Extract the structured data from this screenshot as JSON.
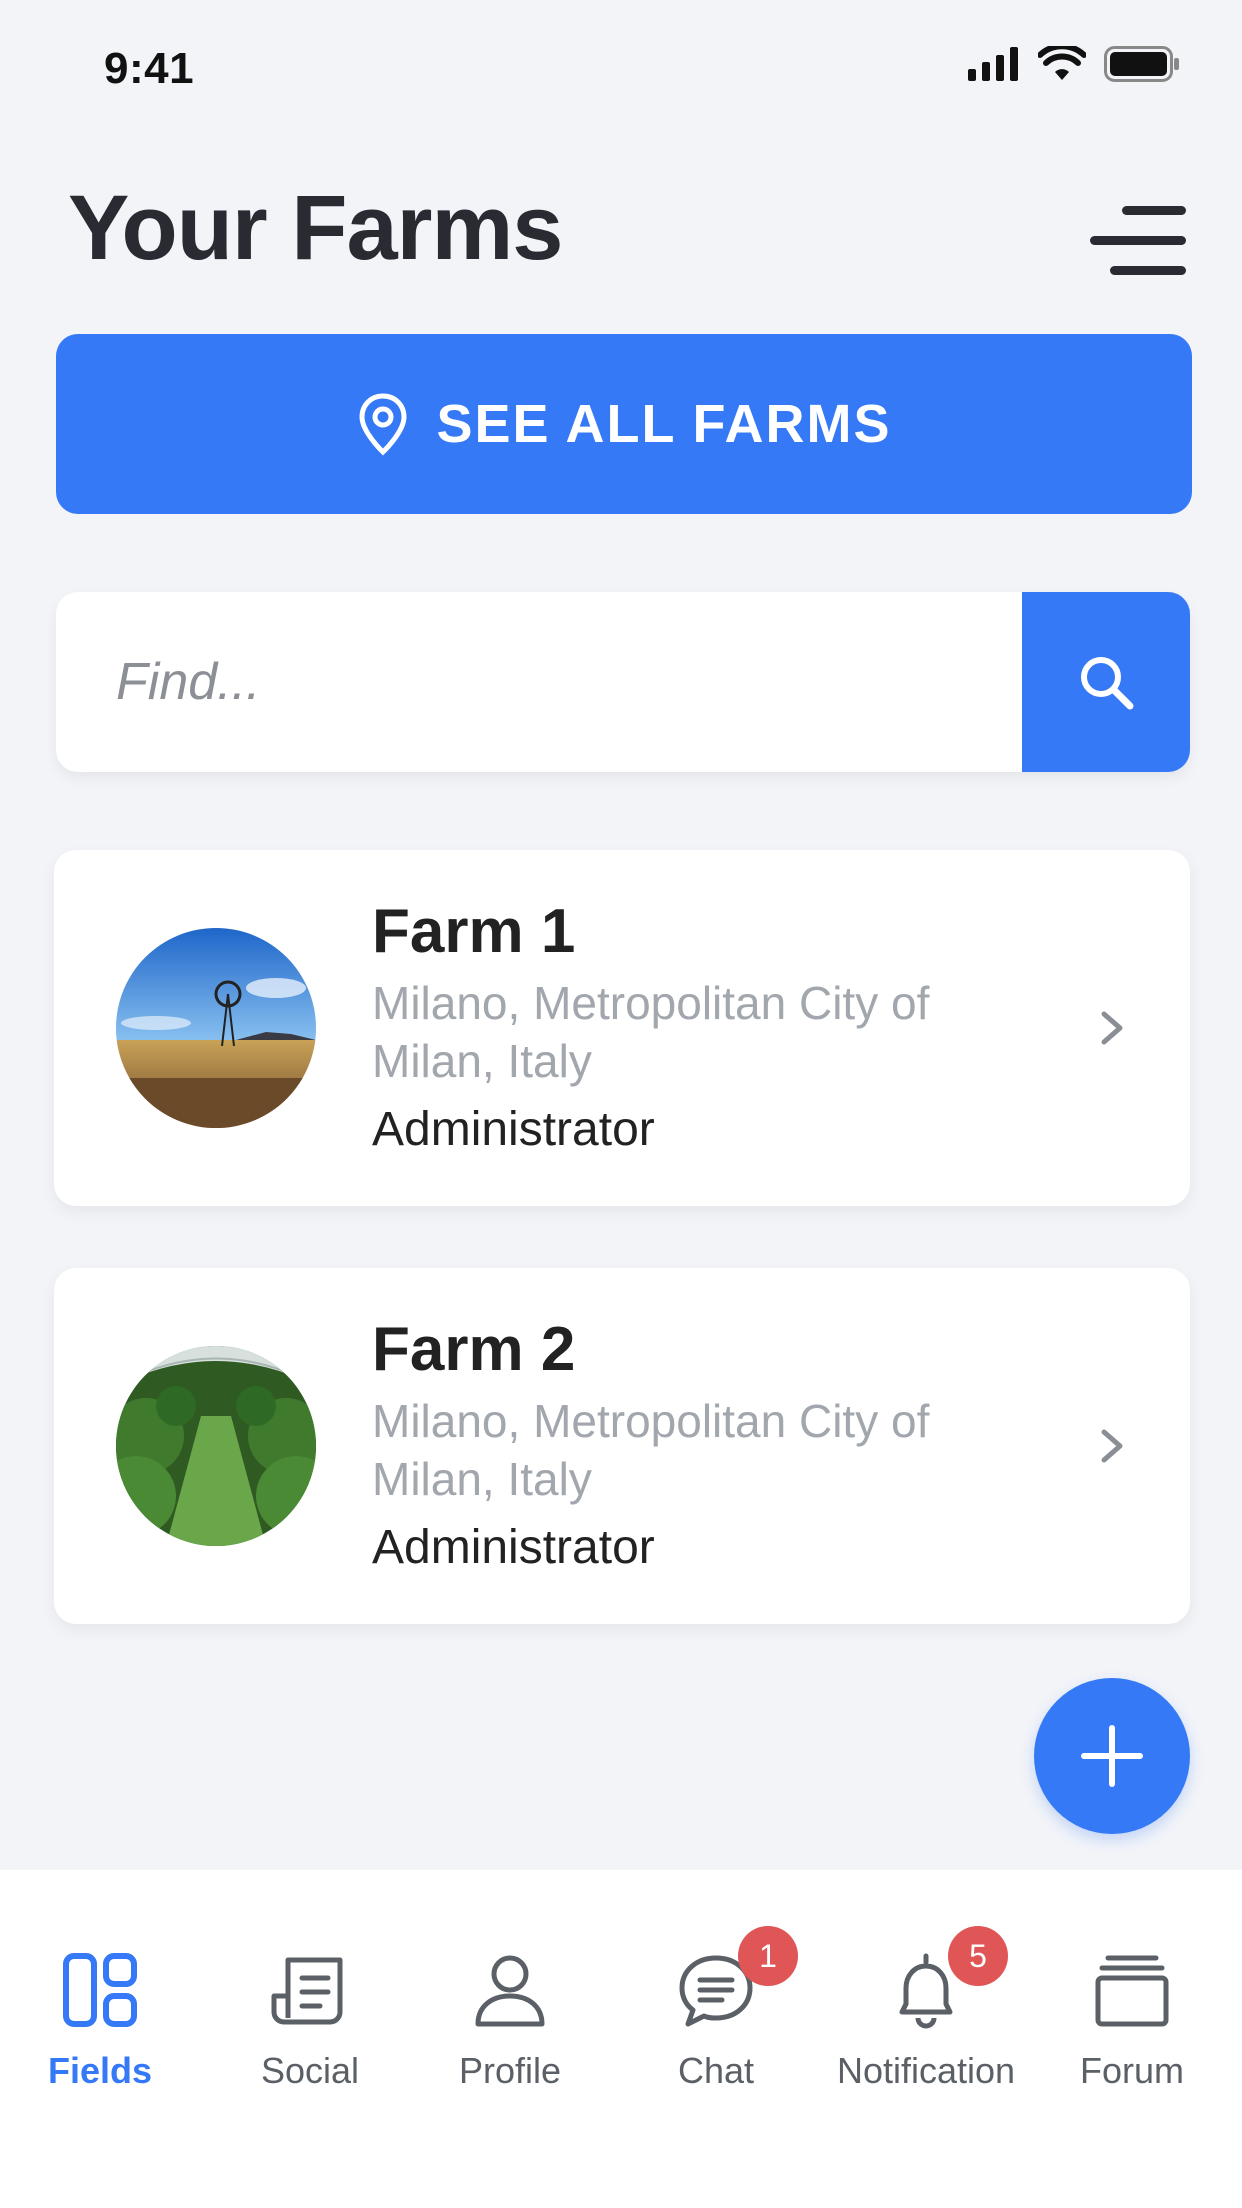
{
  "status_bar": {
    "time": "9:41"
  },
  "header": {
    "title": "Your Farms"
  },
  "see_all": {
    "label": "SEE ALL FARMS",
    "icon": "location-pin-icon"
  },
  "search": {
    "placeholder": "Find...",
    "value": ""
  },
  "farms": [
    {
      "name": "Farm 1",
      "location": "Milano, Metropolitan City of Milan, Italy",
      "role": "Administrator",
      "image": "windmill-field-photo"
    },
    {
      "name": "Farm 2",
      "location": "Milano, Metropolitan City of Milan, Italy",
      "role": "Administrator",
      "image": "greenhouse-plants-photo"
    }
  ],
  "nav": {
    "items": [
      {
        "label": "Fields",
        "icon": "fields-grid-icon",
        "active": true
      },
      {
        "label": "Social",
        "icon": "social-document-icon"
      },
      {
        "label": "Profile",
        "icon": "profile-person-icon"
      },
      {
        "label": "Chat",
        "icon": "chat-bubble-icon",
        "badge": "1"
      },
      {
        "label": "Notification",
        "icon": "bell-icon",
        "badge": "5"
      },
      {
        "label": "Forum",
        "icon": "forum-stack-icon"
      }
    ]
  },
  "colors": {
    "accent": "#3579f6",
    "badge": "#e05555",
    "background": "#f2f4f8"
  }
}
